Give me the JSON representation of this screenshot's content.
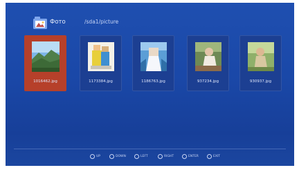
{
  "header": {
    "title": "Фото",
    "path": "/sda1/picture",
    "icon": "photo-folder-icon"
  },
  "files": [
    {
      "name": "1016462.jpg",
      "selected": true
    },
    {
      "name": "1173384.jpg",
      "selected": false
    },
    {
      "name": "1186763.jpg",
      "selected": false
    },
    {
      "name": "937234.jpg",
      "selected": false
    },
    {
      "name": "930937.jpg",
      "selected": false
    }
  ],
  "footer": {
    "hints": [
      {
        "icon": "up-icon",
        "label": "UP"
      },
      {
        "icon": "down-icon",
        "label": "DOWN"
      },
      {
        "icon": "left-icon",
        "label": "LEFT"
      },
      {
        "icon": "right-icon",
        "label": "RIGHT"
      },
      {
        "icon": "enter-icon",
        "label": "ENTER"
      },
      {
        "icon": "exit-icon",
        "label": "EXIT"
      }
    ]
  },
  "colors": {
    "background": "#1a48a8",
    "selected_tile": "#b6402a",
    "tile": "#1c3f92"
  }
}
